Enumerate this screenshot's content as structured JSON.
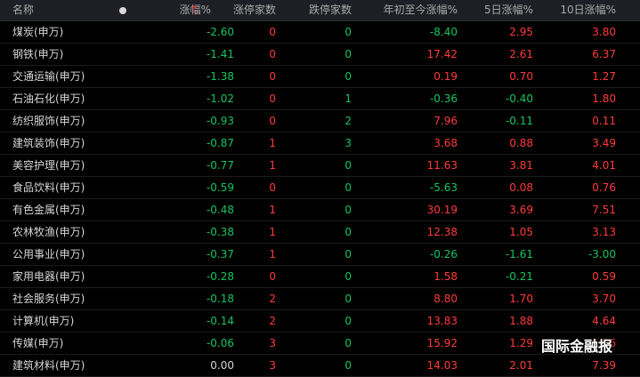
{
  "header": {
    "name": "名称",
    "change_pct": "涨幅%",
    "sort_arrow": "↑",
    "limit_up": "涨停家数",
    "limit_down": "跌停家数",
    "ytd": "年初至今涨幅%",
    "d5": "5日涨幅%",
    "d10": "10日涨幅%"
  },
  "rows": [
    {
      "name": "煤炭(申万)",
      "chg": "-2.60",
      "up": "0",
      "down": "0",
      "ytd": "-8.40",
      "d5": "2.95",
      "d10": "3.80"
    },
    {
      "name": "钢铁(申万)",
      "chg": "-1.41",
      "up": "0",
      "down": "0",
      "ytd": "17.42",
      "d5": "2.61",
      "d10": "6.37"
    },
    {
      "name": "交通运输(申万)",
      "chg": "-1.38",
      "up": "0",
      "down": "0",
      "ytd": "0.19",
      "d5": "0.70",
      "d10": "1.27"
    },
    {
      "name": "石油石化(申万)",
      "chg": "-1.02",
      "up": "0",
      "down": "1",
      "ytd": "-0.36",
      "d5": "-0.40",
      "d10": "1.80"
    },
    {
      "name": "纺织服饰(申万)",
      "chg": "-0.93",
      "up": "0",
      "down": "2",
      "ytd": "7.96",
      "d5": "-0.11",
      "d10": "0.11"
    },
    {
      "name": "建筑装饰(申万)",
      "chg": "-0.87",
      "up": "1",
      "down": "3",
      "ytd": "3.68",
      "d5": "0.88",
      "d10": "3.49"
    },
    {
      "name": "美容护理(申万)",
      "chg": "-0.77",
      "up": "1",
      "down": "0",
      "ytd": "11.63",
      "d5": "3.81",
      "d10": "4.01"
    },
    {
      "name": "食品饮料(申万)",
      "chg": "-0.59",
      "up": "0",
      "down": "0",
      "ytd": "-5.63",
      "d5": "0.08",
      "d10": "0.76"
    },
    {
      "name": "有色金属(申万)",
      "chg": "-0.48",
      "up": "1",
      "down": "0",
      "ytd": "30.19",
      "d5": "3.69",
      "d10": "7.51"
    },
    {
      "name": "农林牧渔(申万)",
      "chg": "-0.38",
      "up": "1",
      "down": "0",
      "ytd": "12.38",
      "d5": "1.05",
      "d10": "3.13"
    },
    {
      "name": "公用事业(申万)",
      "chg": "-0.37",
      "up": "1",
      "down": "0",
      "ytd": "-0.26",
      "d5": "-1.61",
      "d10": "-3.00"
    },
    {
      "name": "家用电器(申万)",
      "chg": "-0.28",
      "up": "0",
      "down": "0",
      "ytd": "1.58",
      "d5": "-0.21",
      "d10": "0.59"
    },
    {
      "name": "社会服务(申万)",
      "chg": "-0.18",
      "up": "2",
      "down": "0",
      "ytd": "8.80",
      "d5": "1.70",
      "d10": "3.70"
    },
    {
      "name": "计算机(申万)",
      "chg": "-0.14",
      "up": "2",
      "down": "0",
      "ytd": "13.83",
      "d5": "1.88",
      "d10": "4.64"
    },
    {
      "name": "传媒(申万)",
      "chg": "-0.06",
      "up": "3",
      "down": "0",
      "ytd": "15.92",
      "d5": "1.29",
      "d10": "1.06"
    },
    {
      "name": "建筑材料(申万)",
      "chg": "0.00",
      "up": "3",
      "down": "0",
      "ytd": "14.03",
      "d5": "2.01",
      "d10": "7.39"
    }
  ],
  "colors": {
    "up": "#ff3b3b",
    "down": "#16c45f",
    "flat": "#d6d6d6",
    "background": "#000000"
  },
  "watermark": "国际金融报"
}
